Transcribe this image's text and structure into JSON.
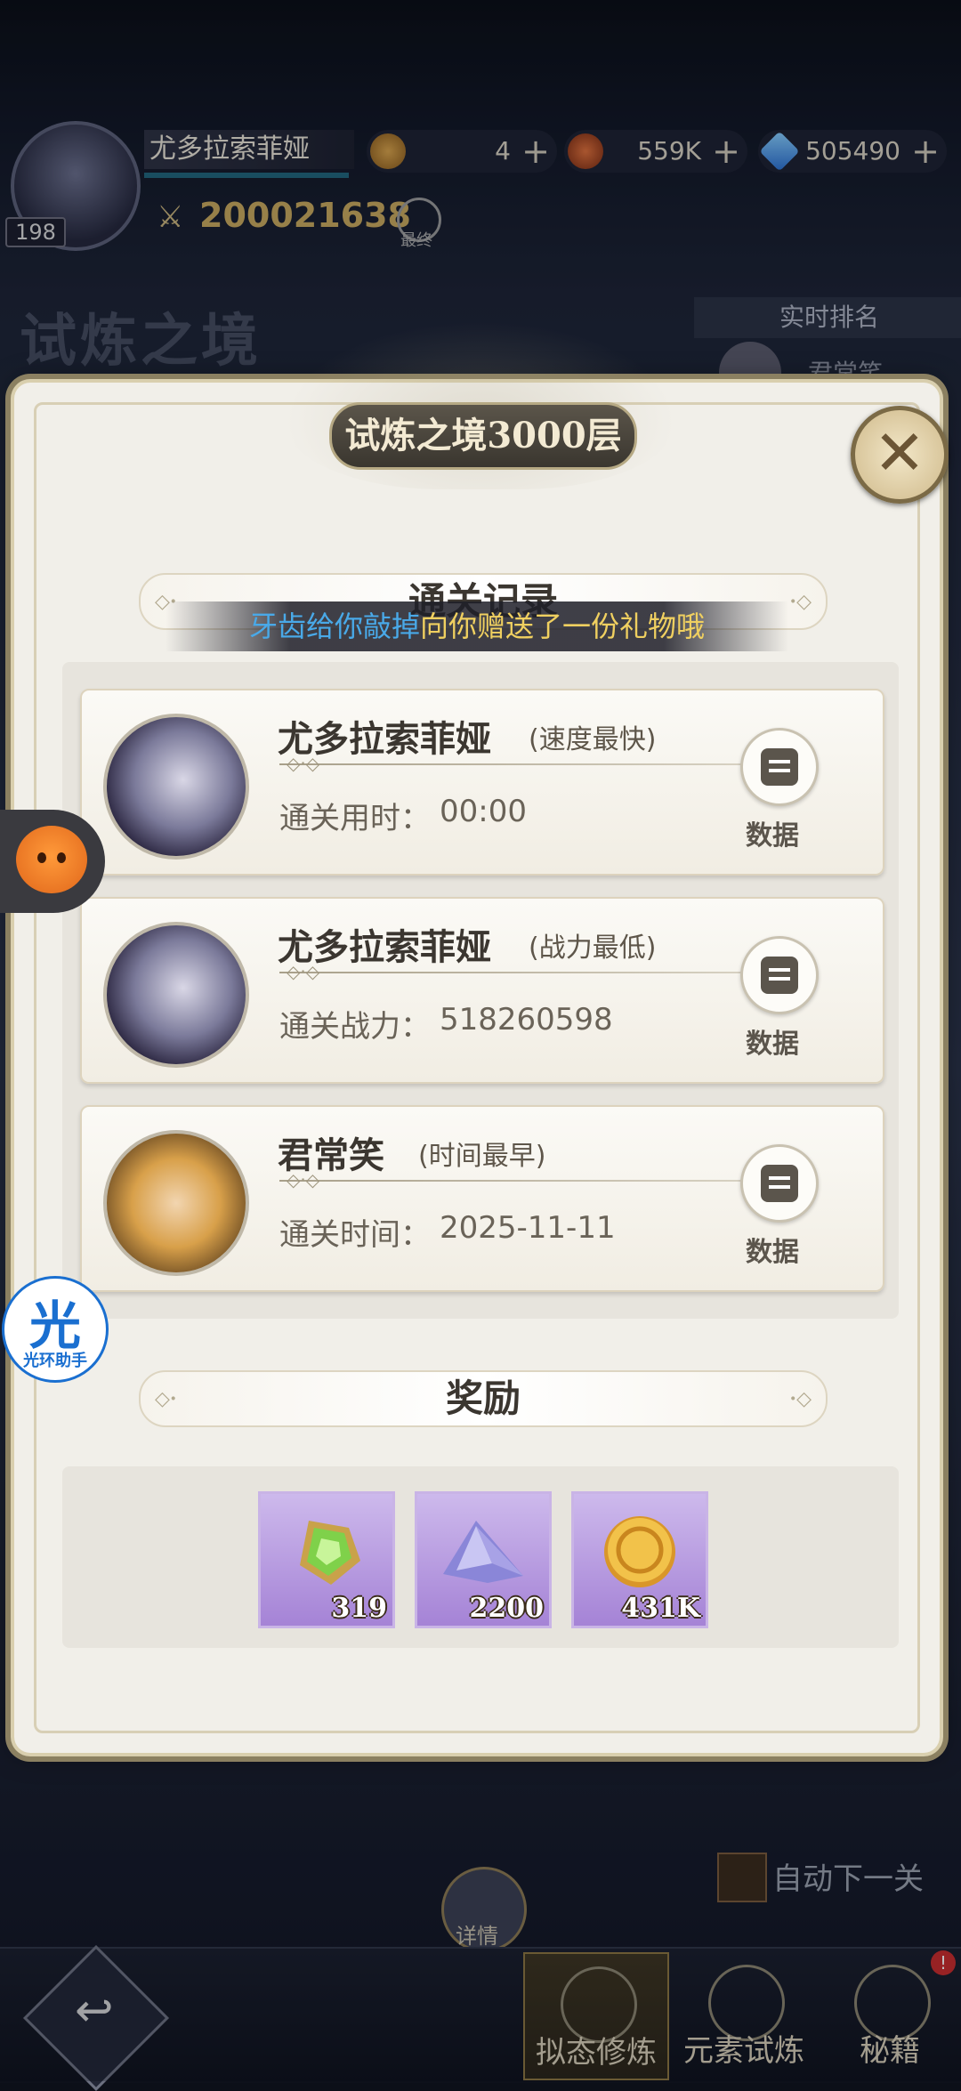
{
  "hud": {
    "player_name": "尤多拉索菲娅",
    "level": "198",
    "power": "200021638",
    "search_label": "最终",
    "resources": [
      {
        "icon": "medal-coin-icon",
        "value": "4"
      },
      {
        "icon": "compass-coin-icon",
        "value": "559K"
      },
      {
        "icon": "diamond-icon",
        "value": "505490"
      }
    ],
    "plus": "+"
  },
  "background": {
    "title": "试炼之境",
    "rank_button": "实时排名",
    "rank_first_name": "君常笑",
    "auto_next": "自动下一关",
    "detail": "详情",
    "tabs": [
      "拟态修炼",
      "元素试炼",
      "秘籍"
    ],
    "tab_badge": "!"
  },
  "dialog": {
    "title": "试炼之境3000层",
    "records_header": "通关记录",
    "gift_sender": "牙齿给你敲掉",
    "gift_message": "向你赠送了一份礼物哦",
    "records": [
      {
        "name": "尤多拉索菲娅",
        "tag": "(速度最快)",
        "label": "通关用时：",
        "value": "00:00",
        "avatar": "dark",
        "button": "数据"
      },
      {
        "name": "尤多拉索菲娅",
        "tag": "(战力最低)",
        "label": "通关战力：",
        "value": "518260598",
        "avatar": "dark",
        "button": "数据"
      },
      {
        "name": "君常笑",
        "tag": "(时间最早)",
        "label": "通关时间：",
        "value": "2025-11-11",
        "avatar": "gold",
        "button": "数据"
      }
    ],
    "rewards_header": "奖励",
    "rewards": [
      {
        "icon": "green-gem-shard-icon",
        "count": "319"
      },
      {
        "icon": "crystal-pile-icon",
        "count": "2200"
      },
      {
        "icon": "gold-coin-icon",
        "count": "431K"
      }
    ]
  },
  "floating": {
    "helper_glyph": "光",
    "helper_label": "光环助手"
  },
  "colors": {
    "accent_gold": "#c9a85c",
    "gift_blue": "#49a9e8",
    "gift_yellow": "#f0d060",
    "reward_purple": "#b79ae2"
  }
}
